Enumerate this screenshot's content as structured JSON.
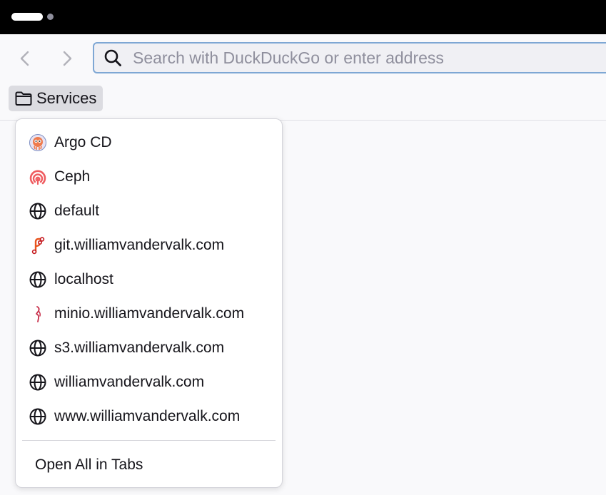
{
  "urlbar": {
    "placeholder": "Search with DuckDuckGo or enter address"
  },
  "bookmarks_bar": {
    "folder_label": "Services"
  },
  "menu": {
    "items": [
      {
        "label": "Argo CD",
        "icon": "argo-cd-icon"
      },
      {
        "label": "Ceph",
        "icon": "ceph-icon"
      },
      {
        "label": "default",
        "icon": "globe-icon"
      },
      {
        "label": "git.williamvandervalk.com",
        "icon": "gitea-icon"
      },
      {
        "label": "localhost",
        "icon": "globe-icon"
      },
      {
        "label": "minio.williamvandervalk.com",
        "icon": "minio-icon"
      },
      {
        "label": "s3.williamvandervalk.com",
        "icon": "globe-icon"
      },
      {
        "label": "williamvandervalk.com",
        "icon": "globe-icon"
      },
      {
        "label": "www.williamvandervalk.com",
        "icon": "globe-icon"
      }
    ],
    "open_all_label": "Open All in Tabs"
  },
  "colors": {
    "titlebar": "#000000",
    "urlbar_focus_border": "#7ea7d4",
    "folder_button_bg": "#dcdce1"
  }
}
